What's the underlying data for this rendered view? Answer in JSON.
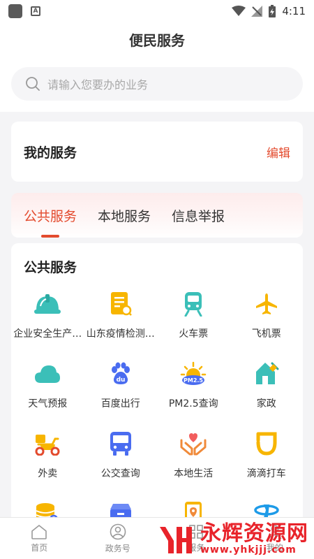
{
  "status_bar": {
    "time": "4:11"
  },
  "header": {
    "title": "便民服务"
  },
  "search": {
    "placeholder": "请输入您要办的业务"
  },
  "my_service": {
    "title": "我的服务",
    "edit_label": "编辑"
  },
  "tabs": [
    {
      "label": "公共服务",
      "active": true
    },
    {
      "label": "本地服务",
      "active": false
    },
    {
      "label": "信息举报",
      "active": false
    }
  ],
  "services": {
    "title": "公共服务",
    "items": [
      {
        "label": "企业安全生产…",
        "icon": "hard-hat-icon"
      },
      {
        "label": "山东疫情检测…",
        "icon": "document-search-icon"
      },
      {
        "label": "火车票",
        "icon": "train-icon"
      },
      {
        "label": "飞机票",
        "icon": "airplane-icon"
      },
      {
        "label": "天气预报",
        "icon": "cloud-icon"
      },
      {
        "label": "百度出行",
        "icon": "baidu-paw-icon"
      },
      {
        "label": "PM2.5查询",
        "icon": "pm25-sun-icon"
      },
      {
        "label": "家政",
        "icon": "house-broom-icon"
      },
      {
        "label": "外卖",
        "icon": "scooter-icon"
      },
      {
        "label": "公交查询",
        "icon": "bus-icon"
      },
      {
        "label": "本地生活",
        "icon": "heart-hands-icon"
      },
      {
        "label": "滴滴打车",
        "icon": "didi-icon"
      },
      {
        "label": "",
        "icon": "coins-search-icon"
      },
      {
        "label": "",
        "icon": "box-icon"
      },
      {
        "label": "",
        "icon": "phone-location-icon"
      },
      {
        "label": "",
        "icon": "telecom-icon"
      }
    ]
  },
  "bottom_nav": [
    {
      "label": "首页",
      "icon": "home-icon"
    },
    {
      "label": "政务号",
      "icon": "person-circle-icon"
    },
    {
      "label": "服务",
      "icon": "grid-icon"
    },
    {
      "label": "我的",
      "icon": "user-icon"
    }
  ],
  "watermark": {
    "name": "永辉资源网",
    "url": "www.yhkjjj.com"
  },
  "colors": {
    "accent": "#e34a2d",
    "teal": "#3bbfb8",
    "yellow": "#f7b500",
    "blue": "#4a6cf0"
  }
}
